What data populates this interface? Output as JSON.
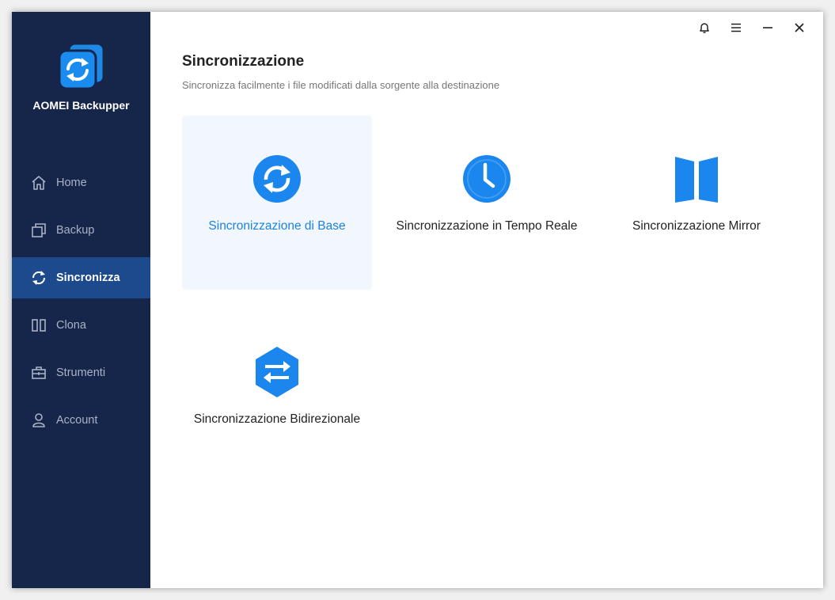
{
  "app": {
    "name": "AOMEI Backupper"
  },
  "sidebar": {
    "items": [
      {
        "label": "Home",
        "icon": "home-icon",
        "active": false
      },
      {
        "label": "Backup",
        "icon": "backup-icon",
        "active": false
      },
      {
        "label": "Sincronizza",
        "icon": "sync-icon",
        "active": true
      },
      {
        "label": "Clona",
        "icon": "clone-icon",
        "active": false
      },
      {
        "label": "Strumenti",
        "icon": "toolbox-icon",
        "active": false
      },
      {
        "label": "Account",
        "icon": "user-icon",
        "active": false
      }
    ]
  },
  "titlebar": {
    "icons": [
      "bell-icon",
      "menu-icon",
      "minimize-icon",
      "close-icon"
    ]
  },
  "page": {
    "title": "Sincronizzazione",
    "subtitle": "Sincronizza facilmente i file modificati dalla sorgente alla destinazione"
  },
  "options": [
    {
      "label": "Sincronizzazione di Base",
      "icon": "sync-circle-icon",
      "selected": true
    },
    {
      "label": "Sincronizzazione in Tempo Reale",
      "icon": "clock-icon",
      "selected": false
    },
    {
      "label": "Sincronizzazione Mirror",
      "icon": "mirror-icon",
      "selected": false
    },
    {
      "label": "Sincronizzazione Bidirezionale",
      "icon": "two-way-sync-icon",
      "selected": false
    }
  ],
  "colors": {
    "sidebar_bg": "#16254a",
    "sidebar_active": "#1d4a8c",
    "accent": "#1d82e0",
    "card_selected_bg": "#f1f7fd"
  }
}
